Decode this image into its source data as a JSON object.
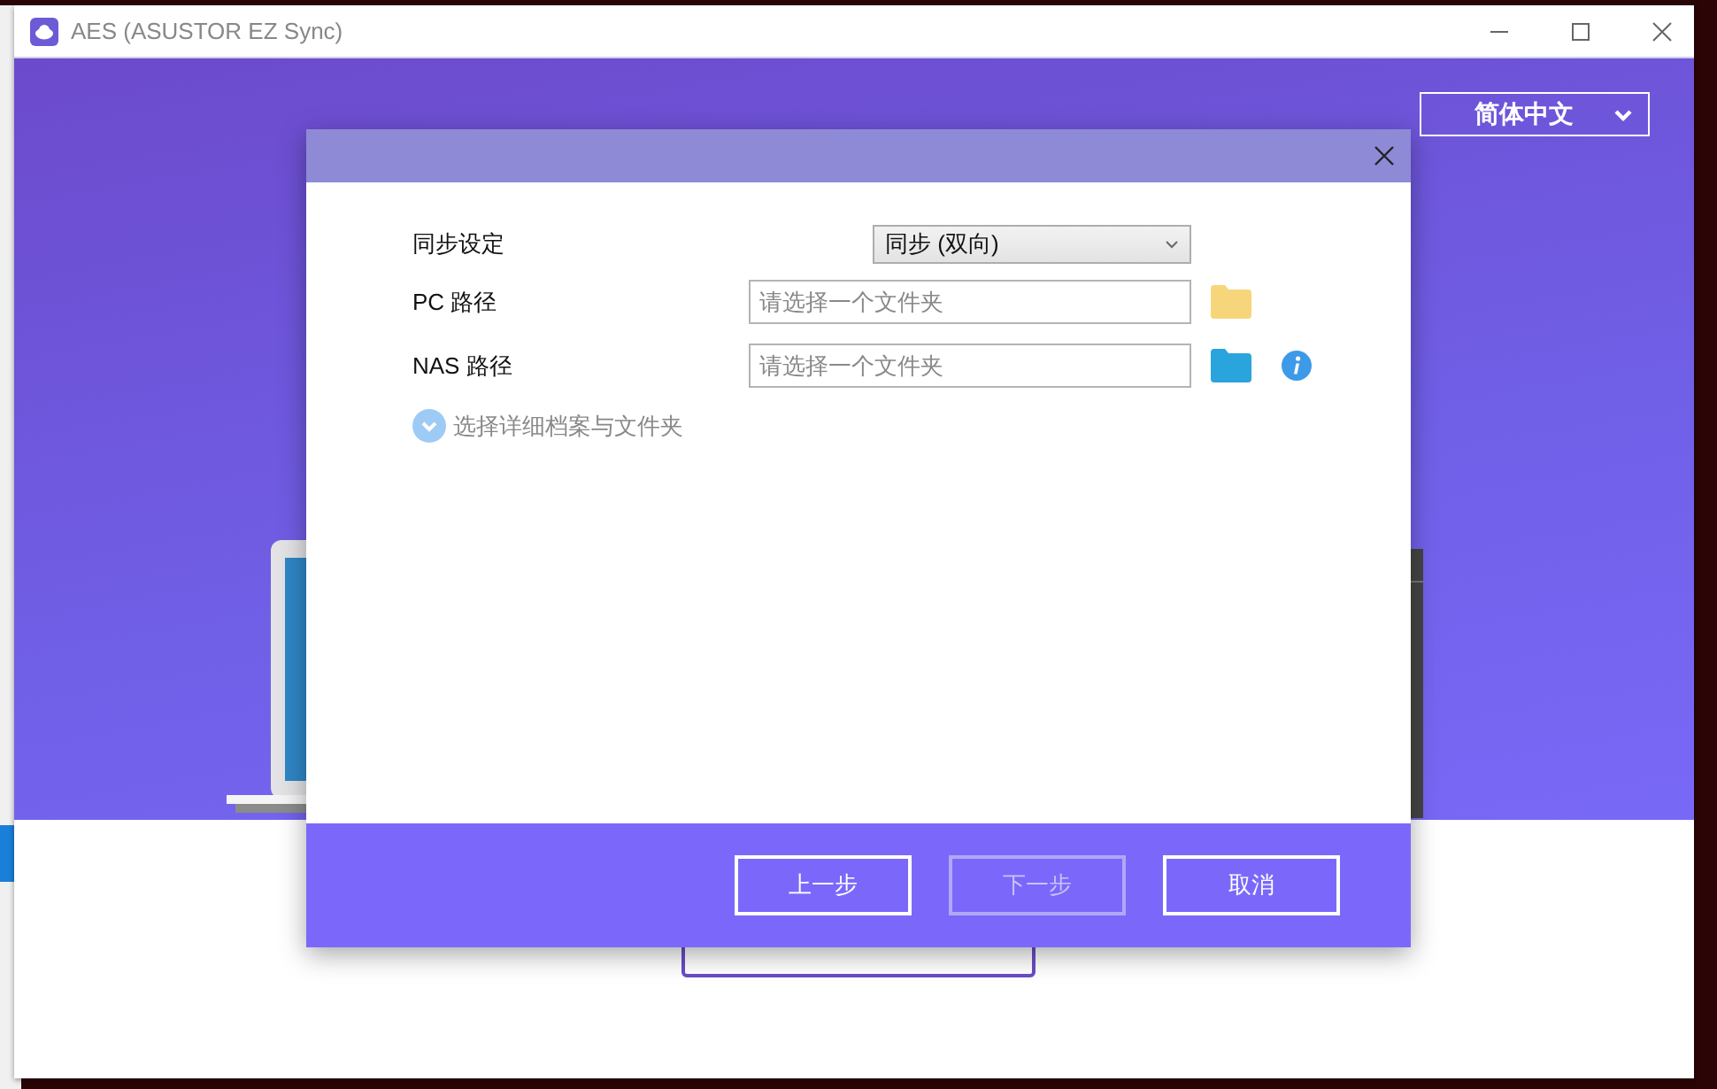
{
  "window": {
    "title": "AES (ASUSTOR EZ Sync)",
    "language": "简体中文"
  },
  "dialog": {
    "fields": [
      {
        "kind": "select",
        "label": "同步设定",
        "value": "同步 (双向)"
      },
      {
        "kind": "path",
        "label": "PC 路径",
        "placeholder": "请选择一个文件夹",
        "color": "#f7d57a",
        "info": false
      },
      {
        "kind": "path",
        "label": "NAS 路径",
        "placeholder": "请选择一个文件夹",
        "color": "#2aa4dd",
        "info": true
      }
    ],
    "details_toggle": {
      "label": "选择详细档案与文件夹",
      "expanded": false
    },
    "buttons": [
      {
        "label": "上一步",
        "disabled": false
      },
      {
        "label": "下一步",
        "disabled": true
      },
      {
        "label": "取消",
        "disabled": false
      }
    ]
  }
}
